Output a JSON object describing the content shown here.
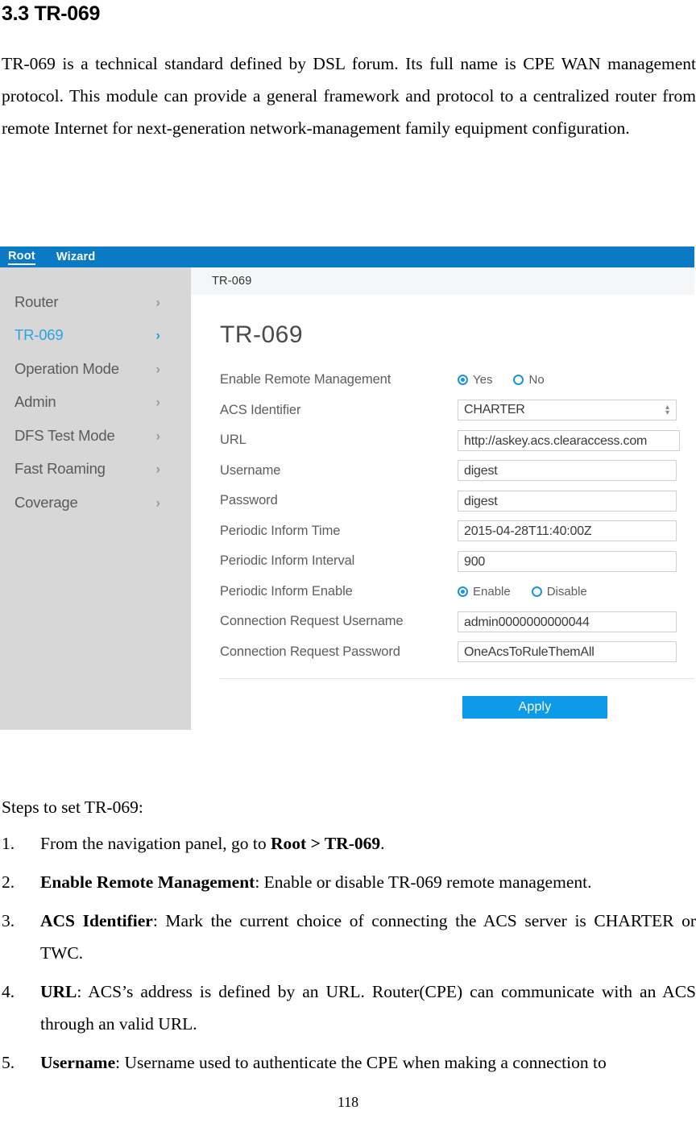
{
  "document": {
    "section_heading": "3.3 TR-069",
    "intro_paragraph": "TR-069 is a technical standard defined by DSL forum. Its full name is CPE WAN management protocol. This module can provide a general framework and protocol to a centralized router from remote Internet for next-generation network-management family equipment configuration.",
    "steps_intro": "Steps to set TR-069:",
    "steps": [
      {
        "lead": "",
        "text_before": "From the navigation panel, go to ",
        "bold": "Root > TR-069",
        "text_after": "."
      },
      {
        "lead": "Enable Remote Management",
        "text_before": "",
        "bold": "Enable Remote Management",
        "text_after": ": Enable or disable TR-069 remote management."
      },
      {
        "lead": "ACS Identifier",
        "text_before": "",
        "bold": "ACS Identifier",
        "text_after": ": Mark the current choice of connecting the ACS server is CHARTER or TWC."
      },
      {
        "lead": "URL",
        "text_before": "",
        "bold": "URL",
        "text_after": ": ACS’s address is defined by an URL. Router(CPE) can communicate with an ACS through an valid URL."
      },
      {
        "lead": "Username",
        "text_before": "",
        "bold": "Username",
        "text_after": ": Username used to authenticate the CPE when making a connection to"
      }
    ],
    "page_number": "118"
  },
  "screenshot": {
    "topbar": {
      "tabs": [
        {
          "label": "Root",
          "active": true
        },
        {
          "label": "Wizard",
          "active": false
        }
      ]
    },
    "sidebar": {
      "items": [
        {
          "label": "Router",
          "active": false,
          "chevron": "›"
        },
        {
          "label": "TR-069",
          "active": true,
          "chevron": "›"
        },
        {
          "label": "Operation Mode",
          "active": false,
          "chevron": "›"
        },
        {
          "label": "Admin",
          "active": false,
          "chevron": "›"
        },
        {
          "label": "DFS Test Mode",
          "active": false,
          "chevron": "›"
        },
        {
          "label": "Fast Roaming",
          "active": false,
          "chevron": "›"
        },
        {
          "label": "Coverage",
          "active": false,
          "chevron": "›"
        }
      ]
    },
    "breadcrumb": "TR-069",
    "panel_title": "TR-069",
    "fields": {
      "enable_remote_management": {
        "label": "Enable Remote Management",
        "options": [
          {
            "label": "Yes",
            "selected": true
          },
          {
            "label": "No",
            "selected": false
          }
        ]
      },
      "acs_identifier": {
        "label": "ACS Identifier",
        "value": "CHARTER"
      },
      "url": {
        "label": "URL",
        "value": "http://askey.acs.clearaccess.com"
      },
      "username": {
        "label": "Username",
        "value": "digest"
      },
      "password": {
        "label": "Password",
        "value": "digest"
      },
      "periodic_inform_time": {
        "label": "Periodic Inform Time",
        "value": "2015-04-28T11:40:00Z"
      },
      "periodic_inform_interval": {
        "label": "Periodic Inform Interval",
        "value": "900"
      },
      "periodic_inform_enable": {
        "label": "Periodic Inform Enable",
        "options": [
          {
            "label": "Enable",
            "selected": true
          },
          {
            "label": "Disable",
            "selected": false
          }
        ]
      },
      "connection_request_username": {
        "label": "Connection Request Username",
        "value": "admin0000000000044"
      },
      "connection_request_password": {
        "label": "Connection Request Password",
        "value": "OneAcsToRuleThemAll"
      }
    },
    "apply_button": "Apply",
    "colors": {
      "topbar_blue": "#0a7ac4",
      "accent_blue": "#1b93db",
      "apply_blue": "#0d9ae8",
      "sidebar_gray": "#d7d7d7",
      "active_item_blue": "#29a3e3"
    }
  }
}
